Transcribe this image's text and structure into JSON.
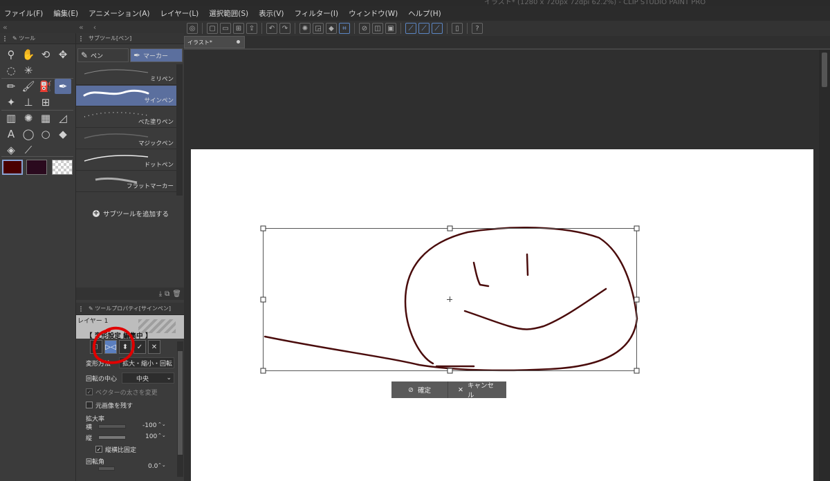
{
  "app_title": "イラスト* (1280 x 720px 72dpi 62.2%) - CLIP STUDIO PAINT PRO",
  "menu": [
    "ファイル(F)",
    "編集(E)",
    "アニメーション(A)",
    "レイヤー(L)",
    "選択範囲(S)",
    "表示(V)",
    "フィルター(I)",
    "ウィンドウ(W)",
    "ヘルプ(H)"
  ],
  "tool_panel": {
    "title": "ツール"
  },
  "sub_tool_panel": {
    "title": "サブツール[ペン]",
    "tabs": [
      "ペン",
      "マーカー"
    ],
    "items": [
      "ミリペン",
      "サインペン",
      "べた塗りペン",
      "マジックペン",
      "ドットペン",
      "フラットマーカー"
    ],
    "selected_item": "サインペン",
    "add_label": "サブツールを追加する"
  },
  "tool_property": {
    "title": "ツールプロパティ[サインペン]",
    "layer_name": "レイヤー 1",
    "status": "【 変形設定 編集中 】",
    "transform_method_label": "変形方法",
    "transform_method_value": "拡大・縮小・回転",
    "rotation_center_label": "回転の中心",
    "rotation_center_value": "中央",
    "vector_width_label": "ベクターの太さを変更",
    "keep_original_label": "元画像を残す",
    "scale_label": "拡大率",
    "horizontal_label": "横",
    "horizontal_value": "-100",
    "vertical_label": "縦",
    "vertical_value": "100",
    "keep_ratio_label": "縦横比固定",
    "rotation_label": "回転角",
    "rotation_value": "0.0"
  },
  "document_tab": "イラスト*",
  "transform_bar": {
    "confirm": "確定",
    "cancel": "キャンセル"
  },
  "colors": {
    "main": "#4a0000",
    "sub": "#2a0a1e",
    "accent": "#5b7fbf",
    "stroke": "#4a0c0c",
    "annotation": "#e00000"
  }
}
